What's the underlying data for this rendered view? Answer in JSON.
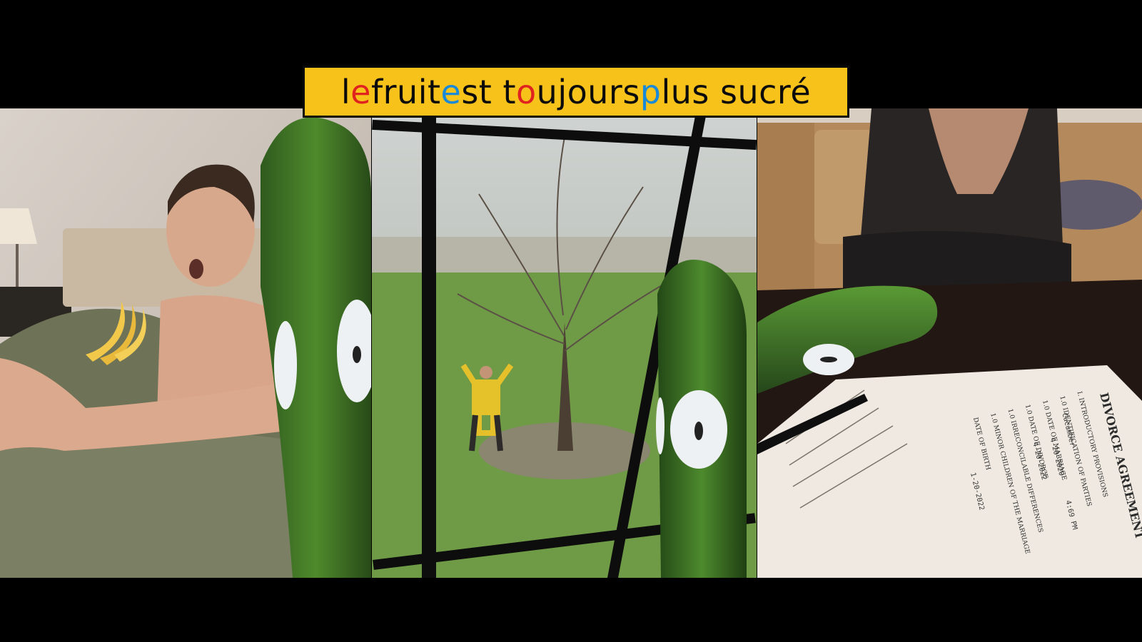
{
  "caption": {
    "segments": [
      {
        "text": "l",
        "color": "#0b0b0b"
      },
      {
        "text": "e",
        "color": "#e0231f"
      },
      {
        "text": " fruit ",
        "color": "#0b0b0b"
      },
      {
        "text": "e",
        "color": "#1a8ad8"
      },
      {
        "text": "st t",
        "color": "#0b0b0b"
      },
      {
        "text": "o",
        "color": "#e0231f"
      },
      {
        "text": "ujours ",
        "color": "#0b0b0b"
      },
      {
        "text": "p",
        "color": "#1a8ad8"
      },
      {
        "text": "lus sucré",
        "color": "#0b0b0b"
      }
    ],
    "background": "#f7c21a"
  },
  "document": {
    "heading": "DIVORCE AGREEMENT",
    "lines": [
      "I. INTRODUCTORY PROVISIONS",
      "1.0 IDENTIFICATION OF PARTIES",
      "1.0 DATE OF MARRIAGE",
      "1.0 DATE OF DIVORCE",
      "1.0 IRRECONCILABLE DIFFERENCES",
      "1.0 MINOR CHILDREN OF THE MARRIAGE",
      "DATE OF BIRTH"
    ],
    "filled": [
      "Cucumber",
      "4-20-2020",
      "4:69 PM",
      "4-20-2022",
      "1-20-2022"
    ]
  }
}
